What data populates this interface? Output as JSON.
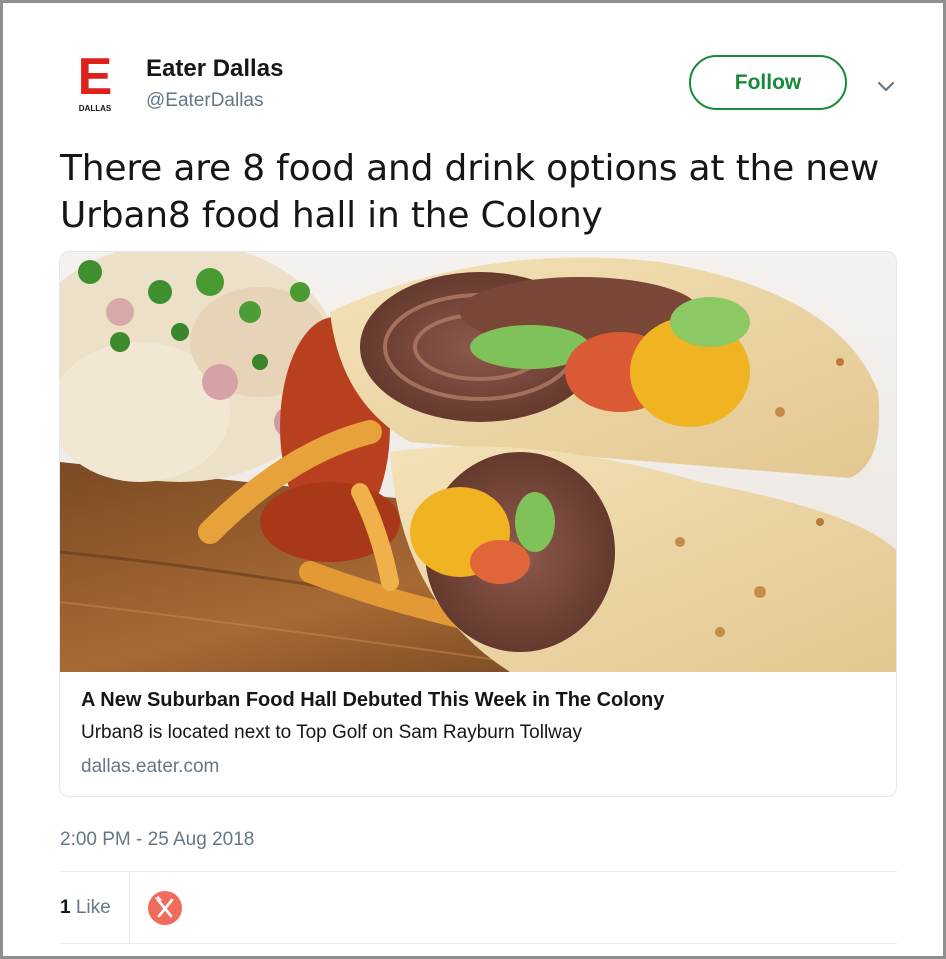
{
  "author": {
    "logo_letter": "E",
    "logo_subtext": "DALLAS",
    "name": "Eater Dallas",
    "handle": "@EaterDallas"
  },
  "follow_label": "Follow",
  "tweet": {
    "text_line1": "There are 8 food and drink options at the new",
    "text_line2": "Urban8 food hall in the Colony",
    "timestamp": "2:00 PM - 25 Aug 2018"
  },
  "card": {
    "title": "A New Suburban Food Hall Debuted This Week in The Colony",
    "description": "Urban8 is located next to Top Golf on Sam Rayburn Tollway",
    "domain": "dallas.eater.com"
  },
  "engagement": {
    "like_count": "1",
    "like_label": "Like"
  },
  "colors": {
    "brand_red": "#e0201b",
    "follow_green": "#1a8a3a",
    "liker_avatar": "#f06b5b"
  },
  "icons": [
    "eater-dallas-logo",
    "chevron-down-icon",
    "fork-knife-avatar-icon"
  ]
}
